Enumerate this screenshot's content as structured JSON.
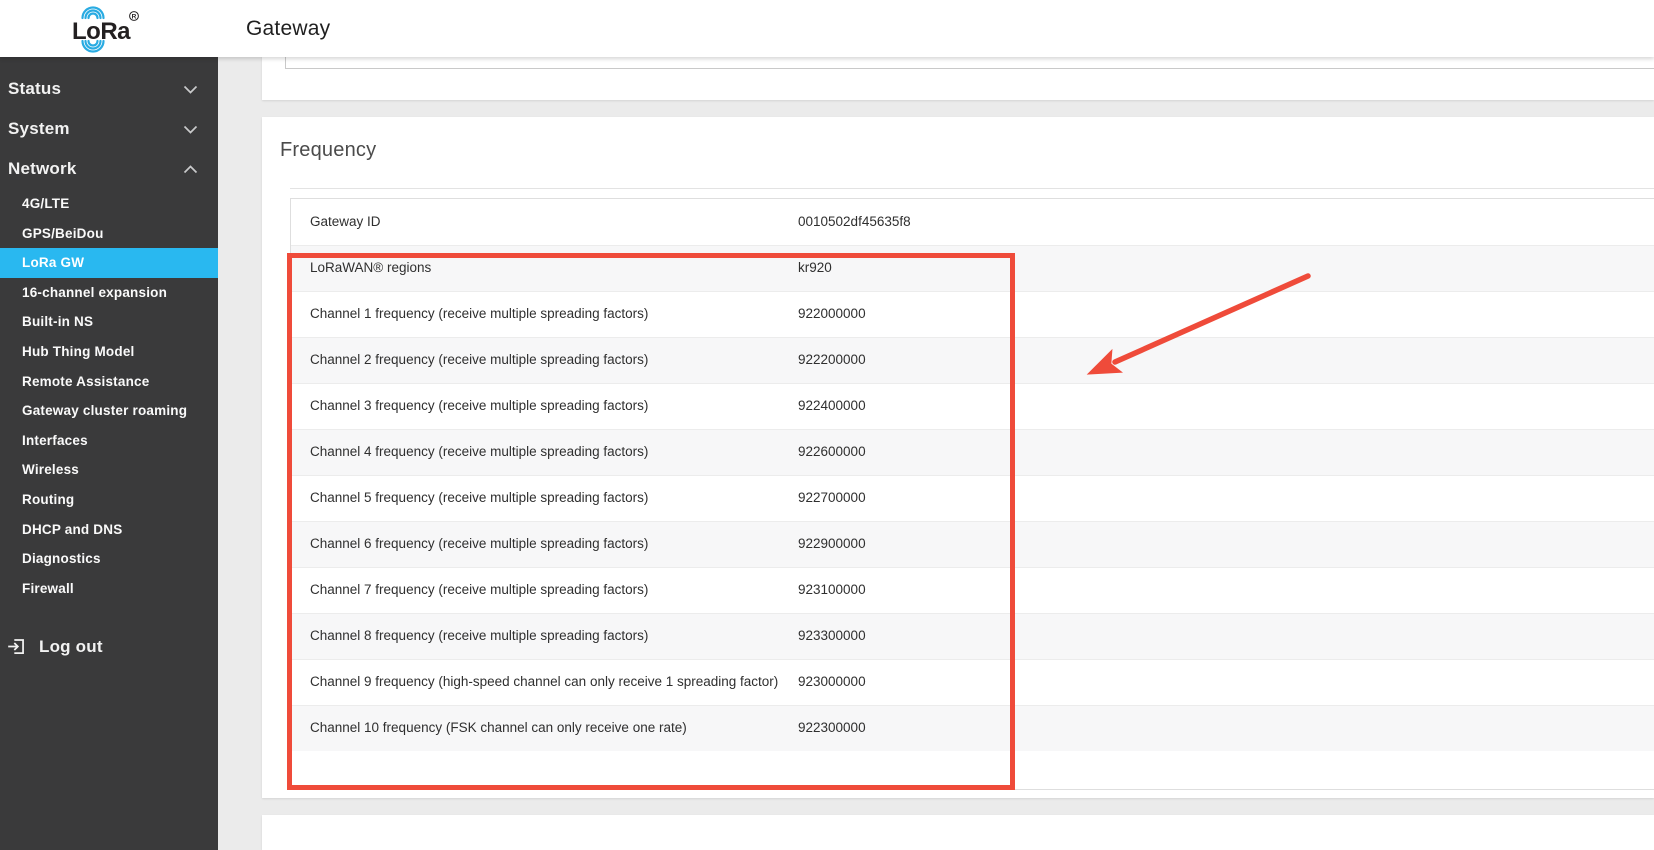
{
  "colors": {
    "accent": "#29b8f0",
    "annotation_red": "#ef4b3a"
  },
  "header": {
    "logo_text": "LoRa",
    "logo_reg": "®",
    "title": "Gateway"
  },
  "sidebar": {
    "sections": [
      {
        "label": "Status",
        "state": "collapsed"
      },
      {
        "label": "System",
        "state": "collapsed"
      },
      {
        "label": "Network",
        "state": "expanded"
      }
    ],
    "network_items": [
      "4G/LTE",
      "GPS/BeiDou",
      "LoRa GW",
      "16-channel expansion",
      "Built-in NS",
      "Hub Thing Model",
      "Remote Assistance",
      "Gateway cluster roaming",
      "Interfaces",
      "Wireless",
      "Routing",
      "DHCP and DNS",
      "Diagnostics",
      "Firewall"
    ],
    "active_item": "LoRa GW",
    "logout_label": "Log out"
  },
  "main": {
    "section_title": "Frequency",
    "table": {
      "rows": [
        {
          "label": "Gateway ID",
          "value": "0010502df45635f8"
        },
        {
          "label": "LoRaWAN® regions",
          "value": "kr920"
        },
        {
          "label": "Channel 1 frequency (receive multiple spreading factors)",
          "value": "922000000"
        },
        {
          "label": "Channel 2 frequency (receive multiple spreading factors)",
          "value": "922200000"
        },
        {
          "label": "Channel 3 frequency (receive multiple spreading factors)",
          "value": "922400000"
        },
        {
          "label": "Channel 4 frequency (receive multiple spreading factors)",
          "value": "922600000"
        },
        {
          "label": "Channel 5 frequency (receive multiple spreading factors)",
          "value": "922700000"
        },
        {
          "label": "Channel 6 frequency (receive multiple spreading factors)",
          "value": "922900000"
        },
        {
          "label": "Channel 7 frequency (receive multiple spreading factors)",
          "value": "923100000"
        },
        {
          "label": "Channel 8 frequency (receive multiple spreading factors)",
          "value": "923300000"
        },
        {
          "label": "Channel 9 frequency (high-speed channel can only receive 1 spreading factor)",
          "value": "923000000"
        },
        {
          "label": "Channel 10 frequency (FSK channel can only receive one rate)",
          "value": "922300000"
        }
      ]
    }
  }
}
